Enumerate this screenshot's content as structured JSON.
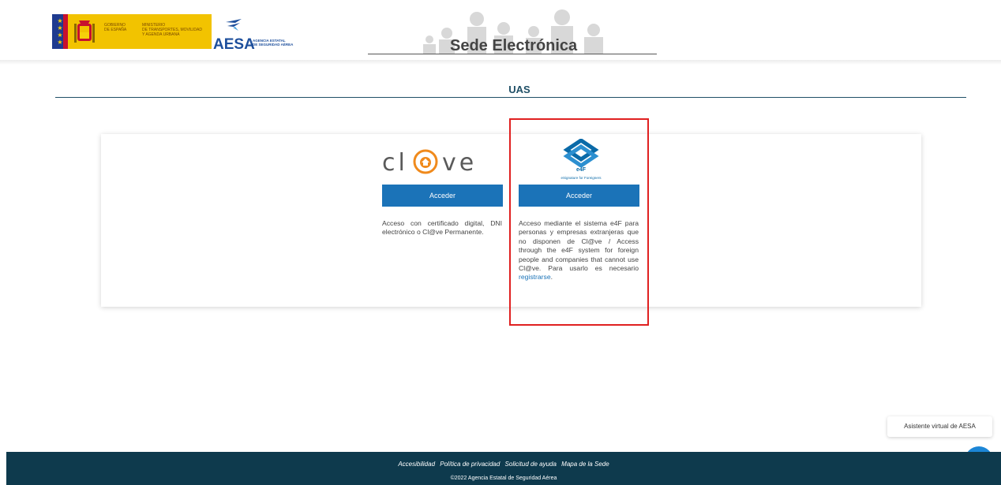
{
  "header": {
    "gov_lines": [
      "GOBIERNO",
      "DE ESPAÑA"
    ],
    "ministry_lines": [
      "MINISTERIO",
      "DE TRANSPORTES, MOVILIDAD",
      "Y AGENDA URBANA"
    ],
    "aesa_word": "AESA",
    "aesa_sub_lines": [
      "AGENCIA ESTATAL",
      "DE SEGURIDAD AÉREA"
    ],
    "sede_title": "Sede Electrónica"
  },
  "section": {
    "title": "UAS"
  },
  "options": [
    {
      "logo_text": "cl@ve",
      "button_label": "Acceder",
      "description": "Acceso con certificado digital, DNI electrónico o Cl@ve Permanente."
    },
    {
      "logo_label": "e4F",
      "logo_sub": "eSignature for Foreigners",
      "button_label": "Acceder",
      "description": "Acceso mediante el sistema e4F para personas y empresas extranjeras que no disponen de Cl@ve / Access through the e4F system for foreign people and companies that cannot use Cl@ve. Para usarlo es necesario ",
      "link_text": "registrarse",
      "link_suffix": "."
    }
  ],
  "chat": {
    "tooltip": "Asistente virtual de AESA",
    "icon": "chat-bubble-icon"
  },
  "footer": {
    "links": [
      "Accesibilidad",
      "Política de privacidad",
      "Solicitud de ayuda",
      "Mapa de la Sede"
    ],
    "copyright": "©2022 Agencia Estatal de Seguridad Aérea"
  },
  "colors": {
    "primary_button": "#1b73b8",
    "footer_bg": "#0e3a4d",
    "highlight": "#e02020",
    "clave_accent": "#f08a1c"
  }
}
